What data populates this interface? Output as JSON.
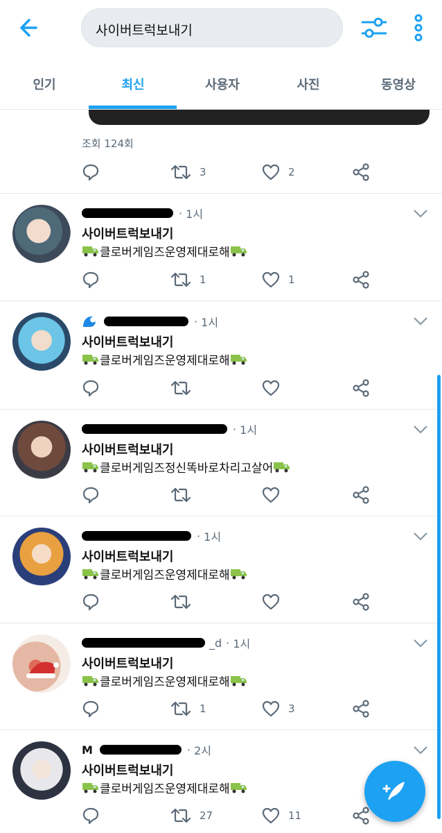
{
  "search": {
    "value": "사이버트럭보내기"
  },
  "tabs": [
    {
      "label": "인기"
    },
    {
      "label": "최신"
    },
    {
      "label": "사용자"
    },
    {
      "label": "사진"
    },
    {
      "label": "동영상"
    }
  ],
  "active_tab": "최신",
  "prev_tweet": {
    "views": "조회 124회",
    "retweets": "3",
    "likes": "2"
  },
  "tweets": [
    {
      "handle_visible": "",
      "time": "1시",
      "title": "사이버트럭보내기",
      "body": "클로버게임즈운영제대로해",
      "retweets": "1",
      "likes": "1"
    },
    {
      "handle_visible": "",
      "time": "1시",
      "title": "사이버트럭보내기",
      "body": "클로버게임즈운영제대로해",
      "retweets": "",
      "likes": ""
    },
    {
      "handle_visible": "",
      "time": "1시",
      "title": "사이버트럭보내기",
      "body": "클로버게임즈정신똑바로차리고살어",
      "retweets": "",
      "likes": ""
    },
    {
      "handle_visible": "",
      "time": "1시",
      "title": "사이버트럭보내기",
      "body": "클로버게임즈운영제대로해",
      "retweets": "",
      "likes": ""
    },
    {
      "handle_visible": "_d",
      "time": "1시",
      "title": "사이버트럭보내기",
      "body": "클로버게임즈운영제대로해",
      "retweets": "1",
      "likes": "3"
    },
    {
      "handle_visible": "M",
      "time": "2시",
      "title": "사이버트럭보내기",
      "body": "클로버게임즈운영제대로해",
      "retweets": "27",
      "likes": "11"
    }
  ],
  "colors": {
    "accent": "#1da1f2",
    "muted": "#5b6a78",
    "divider": "#e1e8ed"
  },
  "icons": [
    "back-arrow-icon",
    "filter-sliders-icon",
    "more-vertical-icon",
    "reply-icon",
    "retweet-icon",
    "like-icon",
    "share-icon",
    "chevron-down-icon",
    "truck-emoji-icon",
    "compose-feather-icon"
  ]
}
